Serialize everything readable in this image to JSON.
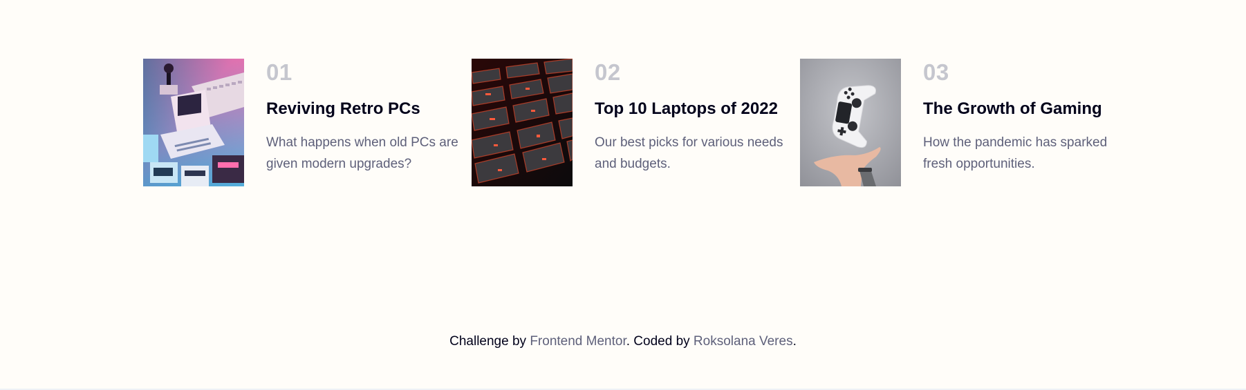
{
  "articles": [
    {
      "number": "01",
      "title": "Reviving Retro PCs",
      "description": "What happens when old PCs are given modern upgrades?",
      "image": "retro-pcs-image"
    },
    {
      "number": "02",
      "title": "Top 10 Laptops of 2022",
      "description": "Our best picks for various needs and budgets.",
      "image": "laptop-keyboard-image"
    },
    {
      "number": "03",
      "title": "The Growth of Gaming",
      "description": "How the pandemic has sparked fresh opportunities.",
      "image": "gaming-controller-image"
    }
  ],
  "attribution": {
    "prefix": "Challenge by ",
    "challenge_link": "Frontend Mentor",
    "middle": ". Coded by ",
    "author_link": "Roksolana Veres",
    "suffix": "."
  },
  "colors": {
    "background": "#fffdf9",
    "number": "#c5c6ce",
    "title": "#00001a",
    "description": "#5e607a"
  }
}
